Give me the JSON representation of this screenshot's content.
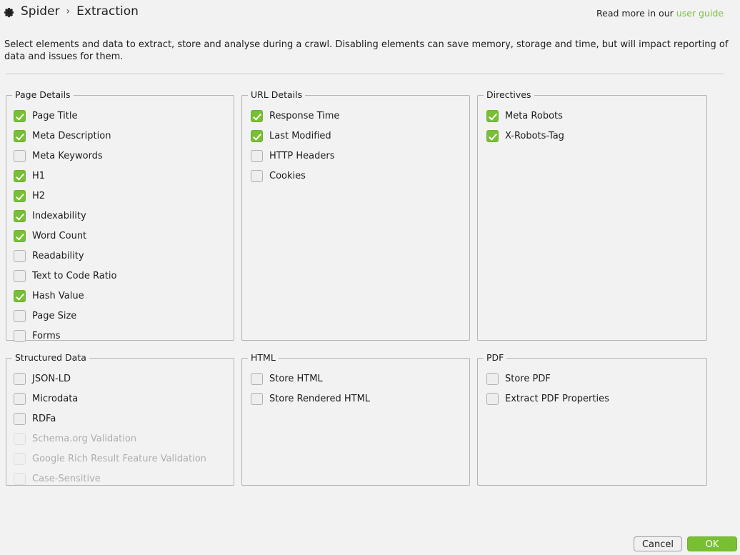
{
  "header": {
    "gear_icon": "gear-icon",
    "breadcrumb_root": "Spider",
    "breadcrumb_separator": "›",
    "breadcrumb_current": "Extraction",
    "read_more_prefix": "Read more in our",
    "read_more_link": "user guide",
    "link_color": "#7ac143"
  },
  "description": "Select elements and data to extract, store and analyse during a crawl. Disabling elements can save memory, storage and time, but will impact reporting of data and issues for them.",
  "groups": {
    "page_details": {
      "title": "Page Details",
      "items": [
        {
          "label": "Page Title",
          "checked": true,
          "disabled": false
        },
        {
          "label": "Meta Description",
          "checked": true,
          "disabled": false
        },
        {
          "label": "Meta Keywords",
          "checked": false,
          "disabled": false
        },
        {
          "label": "H1",
          "checked": true,
          "disabled": false
        },
        {
          "label": "H2",
          "checked": true,
          "disabled": false
        },
        {
          "label": "Indexability",
          "checked": true,
          "disabled": false
        },
        {
          "label": "Word Count",
          "checked": true,
          "disabled": false
        },
        {
          "label": "Readability",
          "checked": false,
          "disabled": false
        },
        {
          "label": "Text to Code Ratio",
          "checked": false,
          "disabled": false
        },
        {
          "label": "Hash Value",
          "checked": true,
          "disabled": false
        },
        {
          "label": "Page Size",
          "checked": false,
          "disabled": false
        },
        {
          "label": "Forms",
          "checked": false,
          "disabled": false
        }
      ]
    },
    "url_details": {
      "title": "URL Details",
      "items": [
        {
          "label": "Response Time",
          "checked": true,
          "disabled": false
        },
        {
          "label": "Last Modified",
          "checked": true,
          "disabled": false
        },
        {
          "label": "HTTP Headers",
          "checked": false,
          "disabled": false
        },
        {
          "label": "Cookies",
          "checked": false,
          "disabled": false
        }
      ]
    },
    "directives": {
      "title": "Directives",
      "items": [
        {
          "label": "Meta Robots",
          "checked": true,
          "disabled": false
        },
        {
          "label": "X-Robots-Tag",
          "checked": true,
          "disabled": false
        }
      ]
    },
    "structured_data": {
      "title": "Structured Data",
      "items": [
        {
          "label": "JSON-LD",
          "checked": false,
          "disabled": false
        },
        {
          "label": "Microdata",
          "checked": false,
          "disabled": false
        },
        {
          "label": "RDFa",
          "checked": false,
          "disabled": false
        },
        {
          "label": "Schema.org Validation",
          "checked": false,
          "disabled": true
        },
        {
          "label": "Google Rich Result Feature Validation",
          "checked": false,
          "disabled": true
        },
        {
          "label": "Case-Sensitive",
          "checked": false,
          "disabled": true
        }
      ]
    },
    "html": {
      "title": "HTML",
      "items": [
        {
          "label": "Store HTML",
          "checked": false,
          "disabled": false
        },
        {
          "label": "Store Rendered HTML",
          "checked": false,
          "disabled": false
        }
      ]
    },
    "pdf": {
      "title": "PDF",
      "items": [
        {
          "label": "Store PDF",
          "checked": false,
          "disabled": false
        },
        {
          "label": "Extract PDF Properties",
          "checked": false,
          "disabled": false
        }
      ]
    }
  },
  "footer": {
    "cancel_label": "Cancel",
    "ok_label": "OK",
    "ok_color": "#78bf33"
  }
}
